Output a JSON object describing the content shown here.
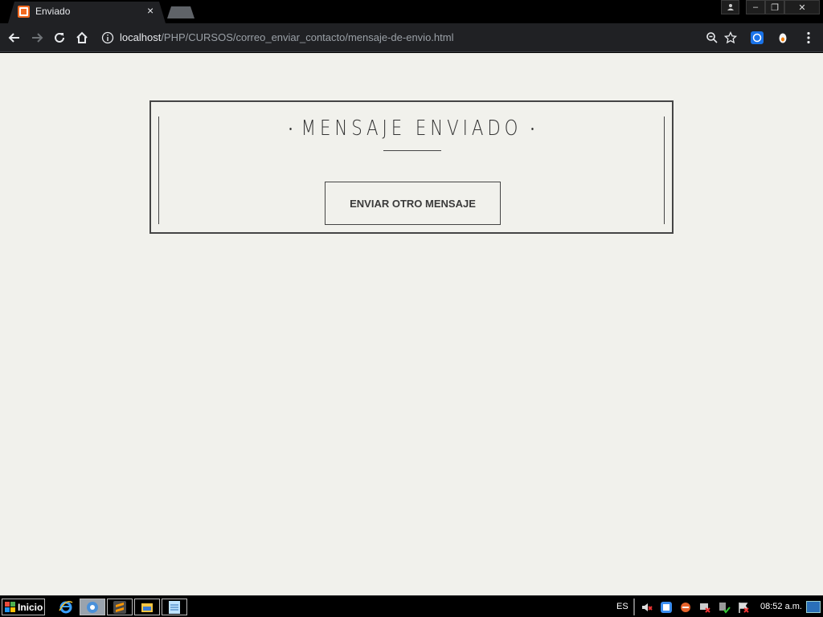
{
  "browser": {
    "tab_title": "Enviado",
    "tab_close": "×",
    "url_host": "localhost",
    "url_path": "/PHP/CURSOS/correo_enviar_contacto/mensaje-de-envio.html",
    "window_buttons": {
      "minimize": "–",
      "maximize": "❐",
      "close": "✕",
      "profile": "●"
    }
  },
  "page": {
    "heading": "MENSAJE ENVIADO",
    "button_label": "ENVIAR OTRO MENSAJE",
    "background_color": "#f1f1ec",
    "border_color": "#454545"
  },
  "taskbar": {
    "start_label": "Inicio",
    "language": "ES",
    "clock": "08:52 a.m.",
    "apps": [
      "internet-explorer-icon",
      "chrome-icon",
      "sublime-text-icon",
      "file-explorer-icon",
      "notepad-icon"
    ],
    "tray": [
      "volume-muted-icon",
      "app-tray-icon",
      "security-icon",
      "network-icon",
      "safe-remove-icon",
      "action-center-icon"
    ]
  }
}
